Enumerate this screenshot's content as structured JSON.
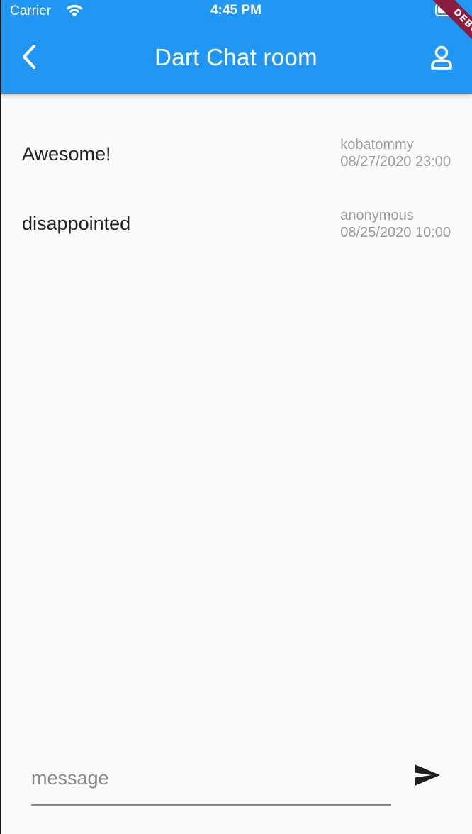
{
  "status_bar": {
    "carrier": "Carrier",
    "time": "4:45 PM",
    "wifi_icon": "wifi-icon",
    "battery_icon": "battery-icon"
  },
  "app_bar": {
    "title": "Dart Chat room",
    "back_icon": "chevron-left-icon",
    "profile_icon": "person-outline-icon",
    "background_color": "#2196f3"
  },
  "debug_banner": {
    "label": "DEBUG",
    "color": "#8d1b3d"
  },
  "messages": [
    {
      "text": "Awesome!",
      "author": "kobatommy",
      "timestamp": "08/27/2020 23:00"
    },
    {
      "text": "disappointed",
      "author": "anonymous",
      "timestamp": "08/25/2020 10:00"
    }
  ],
  "composer": {
    "placeholder": "message",
    "value": "",
    "send_icon": "send-icon"
  }
}
